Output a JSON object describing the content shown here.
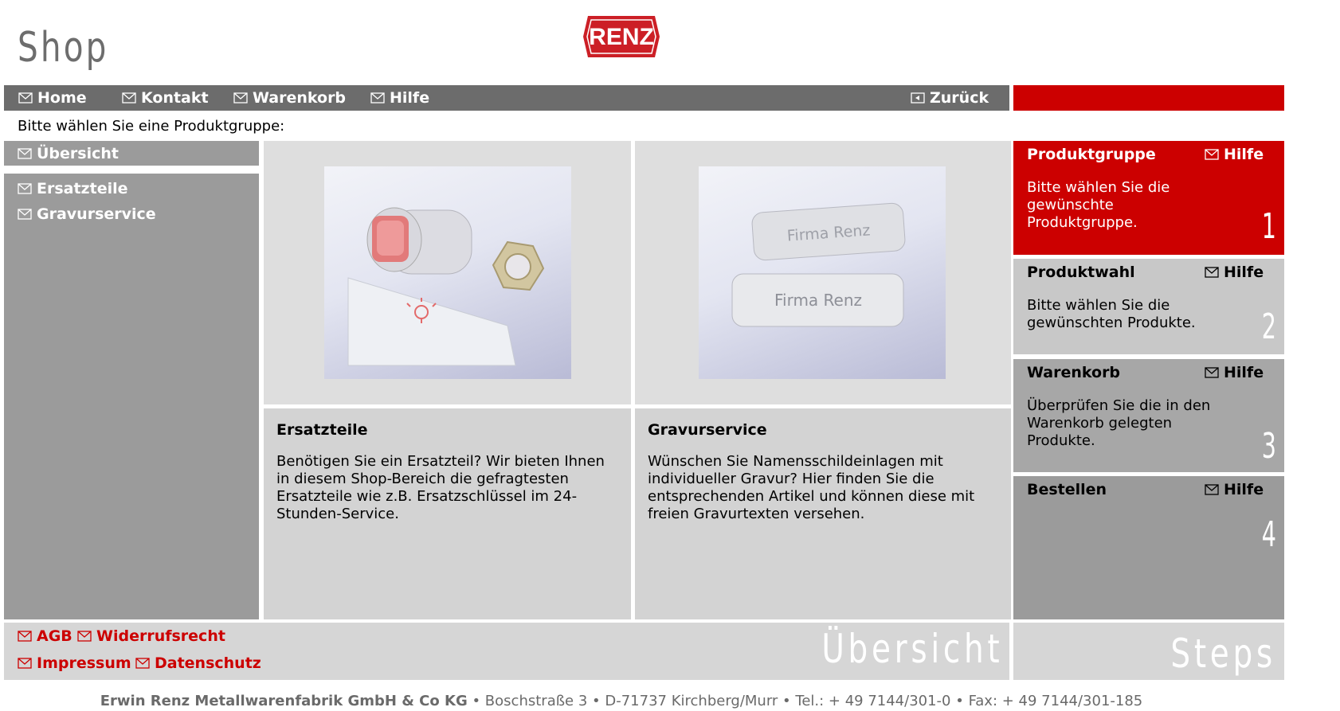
{
  "header": {
    "shop_title": "Shop",
    "logo_text": "RENZ"
  },
  "nav": {
    "home": "Home",
    "kontakt": "Kontakt",
    "warenkorb": "Warenkorb",
    "hilfe": "Hilfe",
    "zurueck": "Zurück"
  },
  "prompt": "Bitte wählen Sie eine Produktgruppe:",
  "sidebar": {
    "uebersicht": "Übersicht",
    "items": [
      {
        "label": "Ersatzteile"
      },
      {
        "label": "Gravurservice"
      }
    ]
  },
  "products": [
    {
      "title": "Ersatzteile",
      "text": "Benötigen Sie ein Ersatzteil? Wir bieten Ihnen in diesem Shop-Bereich die gefragtesten Ersatzteile wie z.B. Ersatzschlüssel im 24-Stunden-Service."
    },
    {
      "title": "Gravurservice",
      "text": "Wünschen Sie Namensschildeinlagen mit individueller Gravur? Hier finden Sie die entsprechenden Artikel und können diese mit freien Gravurtexten versehen.",
      "plate1": "Firma Renz",
      "plate2": "Firma Renz"
    }
  ],
  "steps": [
    {
      "title": "Produktgruppe",
      "help": "Hilfe",
      "text": "Bitte wählen Sie die gewünschte Produktgruppe.",
      "number": "1",
      "active": true
    },
    {
      "title": "Produktwahl",
      "help": "Hilfe",
      "text": "Bitte wählen Sie die gewünschten Produkte.",
      "number": "2",
      "active": false
    },
    {
      "title": "Warenkorb",
      "help": "Hilfe",
      "text": "Überprüfen Sie die in den Warenkorb gelegten Produkte.",
      "number": "3",
      "active": false
    },
    {
      "title": "Bestellen",
      "help": "Hilfe",
      "text": "",
      "number": "4",
      "active": false
    }
  ],
  "footer": {
    "agb": "AGB",
    "widerrufsrecht": "Widerrufsrecht",
    "impressum": "Impressum",
    "datenschutz": "Datenschutz",
    "watermark_left": "Übersicht",
    "watermark_right": "Steps"
  },
  "address": {
    "company": "Erwin Renz Metallwarenfabrik GmbH & Co KG",
    "rest": " • Boschstraße 3 • D-71737 Kirchberg/Murr • Tel.: + 49 7144/301-0 • Fax: + 49 7144/301-185"
  },
  "colors": {
    "brand_red": "#cc0000",
    "nav_gray": "#6c6c6c",
    "panel_gray": "#9b9b9b"
  }
}
